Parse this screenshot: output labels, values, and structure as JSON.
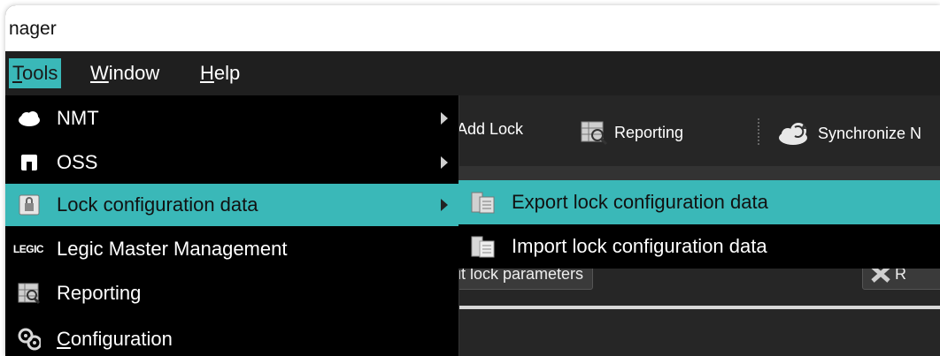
{
  "window": {
    "title": "nager"
  },
  "menubar": {
    "items": [
      {
        "label": "Tools",
        "mnemonic": "T",
        "rest": "ools"
      },
      {
        "label": "Window",
        "mnemonic": "W",
        "rest": "indow"
      },
      {
        "label": "Help",
        "mnemonic": "H",
        "rest": "elp"
      }
    ]
  },
  "toolbar": {
    "add_lock": "Add Lock",
    "reporting": "Reporting",
    "synchronize": "Synchronize N"
  },
  "background": {
    "param_button": "it lock parameters",
    "r_button": "R"
  },
  "tools_menu": {
    "items": [
      {
        "label": "NMT",
        "icon": "cloud-icon"
      },
      {
        "label": "OSS",
        "icon": "oss-icon"
      },
      {
        "label": "Lock configuration data",
        "icon": "lock-config-icon"
      },
      {
        "label": "Legic Master Management",
        "icon": "legic-icon",
        "icon_text": "LEGIC"
      },
      {
        "label": "Reporting",
        "icon": "reporting-icon"
      },
      {
        "label": "Configuration",
        "icon": "configuration-icon",
        "mnemonic": "C",
        "rest": "onfiguration"
      }
    ]
  },
  "submenu": {
    "items": [
      {
        "label": "Export lock configuration data",
        "icon": "export-icon"
      },
      {
        "label": "Import lock configuration data",
        "icon": "import-icon"
      }
    ]
  },
  "colors": {
    "accent": "#3ab8b8",
    "menu_bg": "#000000",
    "menubar_bg": "#1f1f1f"
  }
}
